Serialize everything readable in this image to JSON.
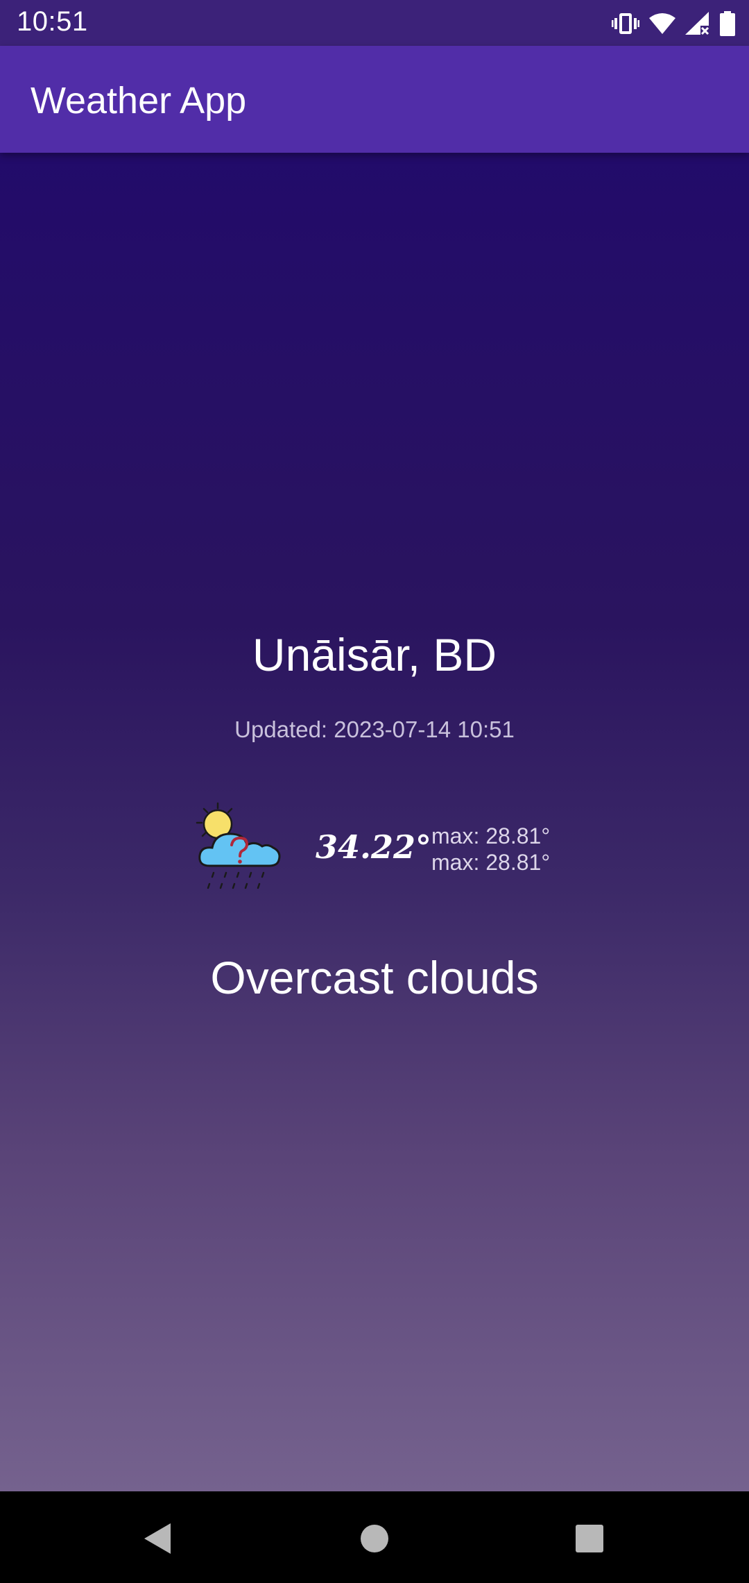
{
  "status_bar": {
    "time": "10:51",
    "icons": [
      "vibrate-icon",
      "wifi-icon",
      "signal-icon",
      "battery-icon"
    ]
  },
  "app_bar": {
    "title": "Weather App",
    "color": "#512da8"
  },
  "weather": {
    "location": "Unāisār, BD",
    "updated": "Updated: 2023-07-14 10:51",
    "icon": "partly-cloudy-rain-question-icon",
    "temperature": "34.22°",
    "max_line_1": "max: 28.81°",
    "max_line_2": "max: 28.81°",
    "description": "Overcast clouds"
  },
  "nav_bar": {
    "buttons": [
      "back-icon",
      "home-icon",
      "recents-icon"
    ]
  }
}
